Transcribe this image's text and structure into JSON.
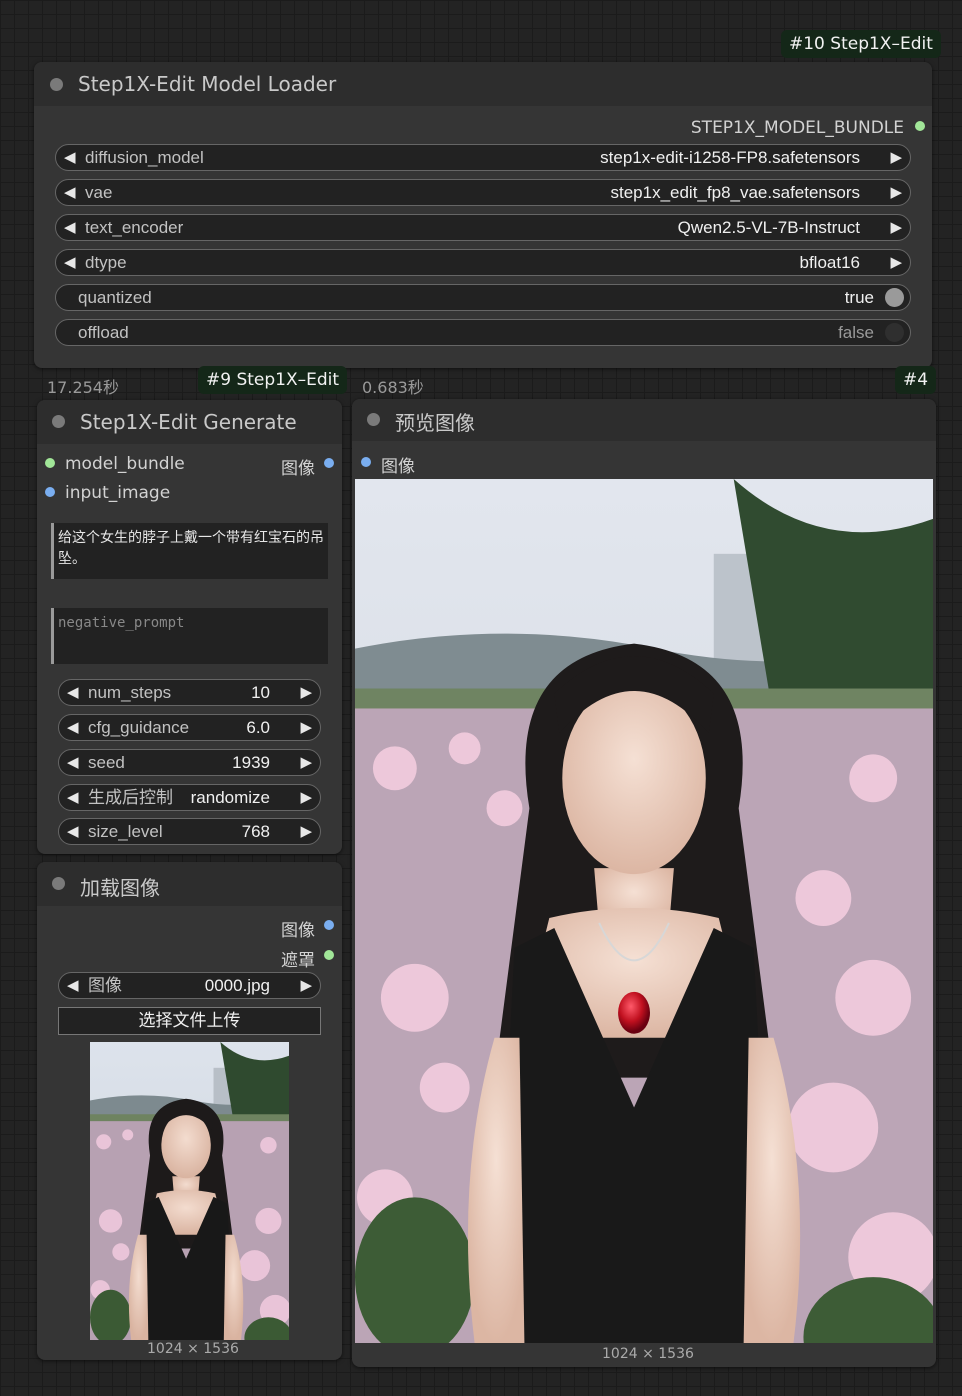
{
  "badges": {
    "node10": "#10 Step1X–Edit",
    "node9": "#9 Step1X–Edit",
    "node4": "#4"
  },
  "loader": {
    "title": "Step1X-Edit Model Loader",
    "output": "STEP1X_MODEL_BUNDLE",
    "widgets": [
      {
        "name": "diffusion_model",
        "value": "step1x-edit-i1258-FP8.safetensors"
      },
      {
        "name": "vae",
        "value": "step1x_edit_fp8_vae.safetensors"
      },
      {
        "name": "text_encoder",
        "value": "Qwen2.5-VL-7B-Instruct"
      },
      {
        "name": "dtype",
        "value": "bfloat16"
      }
    ],
    "toggles": [
      {
        "name": "quantized",
        "value": "true"
      },
      {
        "name": "offload",
        "value": "false"
      }
    ]
  },
  "timings": {
    "generate": "17.254秒",
    "preview": "0.683秒"
  },
  "generate": {
    "title": "Step1X-Edit Generate",
    "inputs": [
      "model_bundle",
      "input_image"
    ],
    "output": "图像",
    "prompt": "给这个女生的脖子上戴一个带有红宝石的吊坠。",
    "negative_placeholder": "negative_prompt",
    "widgets": [
      {
        "name": "num_steps",
        "value": "10"
      },
      {
        "name": "cfg_guidance",
        "value": "6.0"
      },
      {
        "name": "seed",
        "value": "1939"
      },
      {
        "name": "生成后控制",
        "value": "randomize"
      },
      {
        "name": "size_level",
        "value": "768"
      }
    ]
  },
  "load_image": {
    "title": "加载图像",
    "outputs": [
      "图像",
      "遮罩"
    ],
    "widget": {
      "name": "图像",
      "value": "0000.jpg"
    },
    "upload_label": "选择文件上传",
    "dimensions": "1024 × 1536"
  },
  "preview": {
    "title": "预览图像",
    "input": "图像",
    "dimensions": "1024 × 1536"
  },
  "colors": {
    "bundle_slot": "#a1e698",
    "image_slot": "#7aaef0",
    "badge_bg": "#142718"
  }
}
